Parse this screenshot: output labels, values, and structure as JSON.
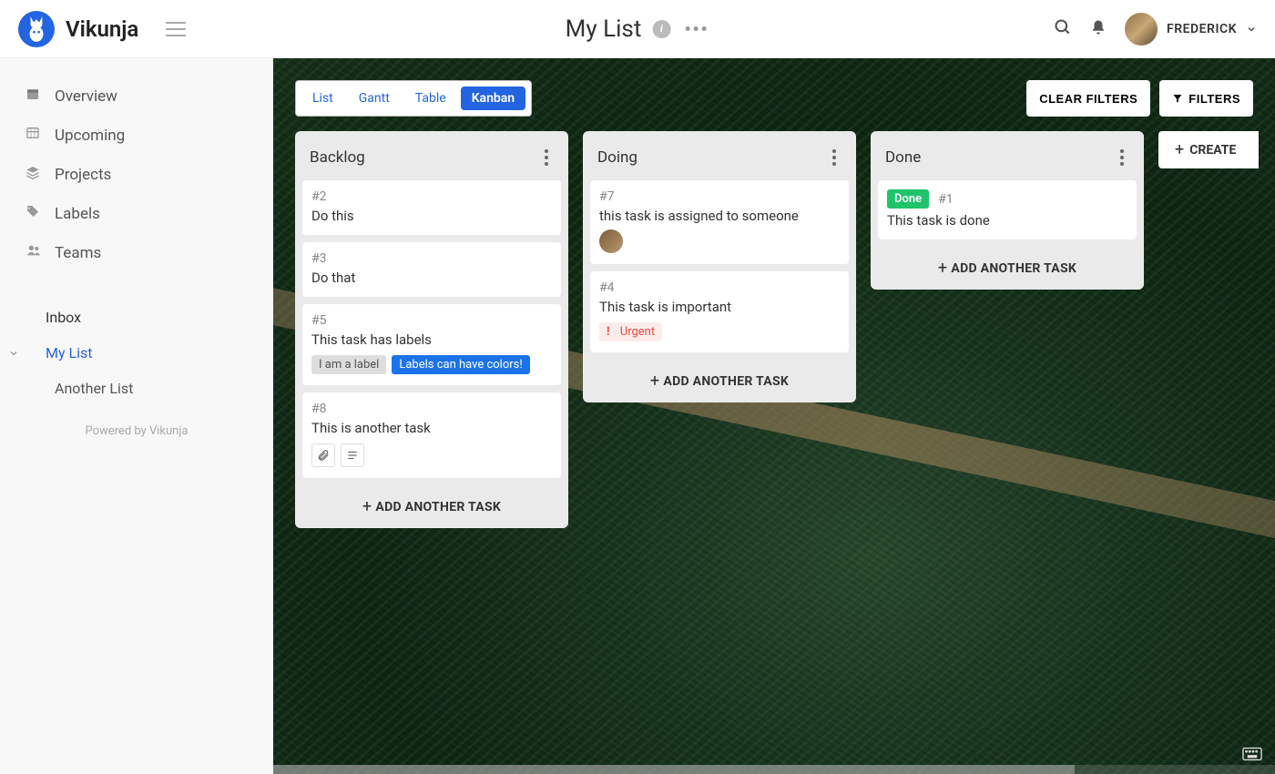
{
  "app_name": "Vikunja",
  "header": {
    "list_title": "My List",
    "user_name": "FREDERICK"
  },
  "sidebar": {
    "nav": [
      {
        "label": "Overview"
      },
      {
        "label": "Upcoming"
      },
      {
        "label": "Projects"
      },
      {
        "label": "Labels"
      },
      {
        "label": "Teams"
      }
    ],
    "inbox_label": "Inbox",
    "active_list": "My List",
    "other_list": "Another List",
    "powered": "Powered by Vikunja"
  },
  "views": {
    "list": "List",
    "gantt": "Gantt",
    "table": "Table",
    "kanban": "Kanban"
  },
  "filters": {
    "clear": "CLEAR FILTERS",
    "filters": "FILTERS"
  },
  "create_bucket": "CREATE",
  "add_another_task": "ADD ANOTHER TASK",
  "columns": [
    {
      "title": "Backlog",
      "cards": [
        {
          "id": "#2",
          "title": "Do this"
        },
        {
          "id": "#3",
          "title": "Do that"
        },
        {
          "id": "#5",
          "title": "This task has labels",
          "labels": [
            {
              "text": "I am a label",
              "cls": "label-grey"
            },
            {
              "text": "Labels can have colors!",
              "cls": "label-blue"
            }
          ]
        },
        {
          "id": "#8",
          "title": "This is another task",
          "meta_icons": true
        }
      ]
    },
    {
      "title": "Doing",
      "cards": [
        {
          "id": "#7",
          "title": "this task is assigned to someone",
          "assignee": true
        },
        {
          "id": "#4",
          "title": "This task is important",
          "urgent": "Urgent"
        }
      ]
    },
    {
      "title": "Done",
      "cards": [
        {
          "id": "#1",
          "title": "This task is done",
          "done_badge": "Done"
        }
      ]
    }
  ]
}
